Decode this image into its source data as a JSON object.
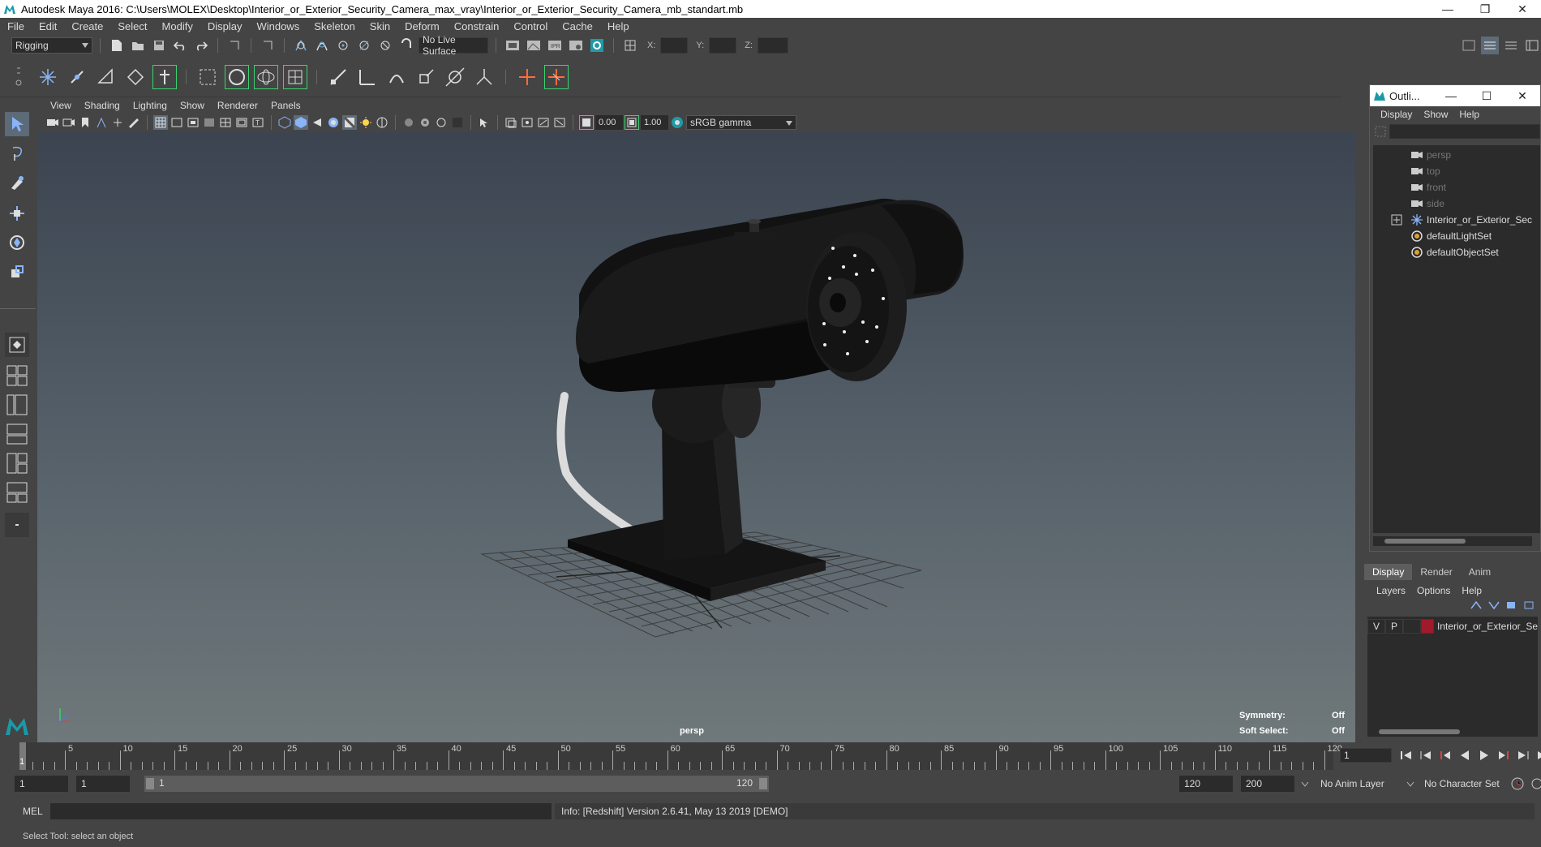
{
  "window": {
    "title": "Autodesk Maya 2016: C:\\Users\\MOLEX\\Desktop\\Interior_or_Exterior_Security_Camera_max_vray\\Interior_or_Exterior_Security_Camera_mb_standart.mb",
    "minimize": "—",
    "restore": "❐",
    "close": "✕"
  },
  "menubar": [
    "File",
    "Edit",
    "Create",
    "Select",
    "Modify",
    "Display",
    "Windows",
    "Skeleton",
    "Skin",
    "Deform",
    "Constrain",
    "Control",
    "Cache",
    "Help"
  ],
  "statusline": {
    "menuset": "Rigging",
    "live_surface": "No Live Surface",
    "x_label": "X:",
    "y_label": "Y:",
    "z_label": "Z:"
  },
  "viewport": {
    "menus": [
      "View",
      "Shading",
      "Lighting",
      "Show",
      "Renderer",
      "Panels"
    ],
    "exposure": "0.00",
    "gamma": "1.00",
    "color_space": "sRGB gamma",
    "camera_label": "persp",
    "symmetry_label": "Symmetry:",
    "symmetry_value": "Off",
    "soft_select_label": "Soft Select:",
    "soft_select_value": "Off"
  },
  "outliner": {
    "title": "Outli...",
    "menus": [
      "Display",
      "Show",
      "Help"
    ],
    "items": [
      {
        "label": "persp",
        "dim": true
      },
      {
        "label": "top",
        "dim": true
      },
      {
        "label": "front",
        "dim": true
      },
      {
        "label": "side",
        "dim": true
      },
      {
        "label": "Interior_or_Exterior_Secu",
        "dim": false
      },
      {
        "label": "defaultLightSet",
        "dim": false
      },
      {
        "label": "defaultObjectSet",
        "dim": false
      }
    ]
  },
  "layer_editor": {
    "tabs": [
      "Display",
      "Render",
      "Anim"
    ],
    "menus": [
      "Layers",
      "Options",
      "Help"
    ],
    "layer": {
      "v": "V",
      "p": "P",
      "name": "Interior_or_Exterior_Se",
      "color": "#a01a2c"
    }
  },
  "timeline": {
    "ticks": [
      "5",
      "10",
      "15",
      "20",
      "25",
      "30",
      "35",
      "40",
      "45",
      "50",
      "55",
      "60",
      "65",
      "70",
      "75",
      "80",
      "85",
      "90",
      "95",
      "100",
      "105",
      "110",
      "115",
      "120"
    ],
    "current_marker": "1",
    "current_frame": "1"
  },
  "range": {
    "start": "1",
    "playback_start": "1",
    "slider_start": "1",
    "slider_end": "120",
    "playback_end": "120",
    "end": "200",
    "anim_layer": "No Anim Layer",
    "character_set": "No Character Set"
  },
  "commandline": {
    "label": "MEL",
    "output": "Info:  [Redshift] Version 2.6.41, May 13 2019 [DEMO]"
  },
  "helpline": "Select Tool: select an object"
}
